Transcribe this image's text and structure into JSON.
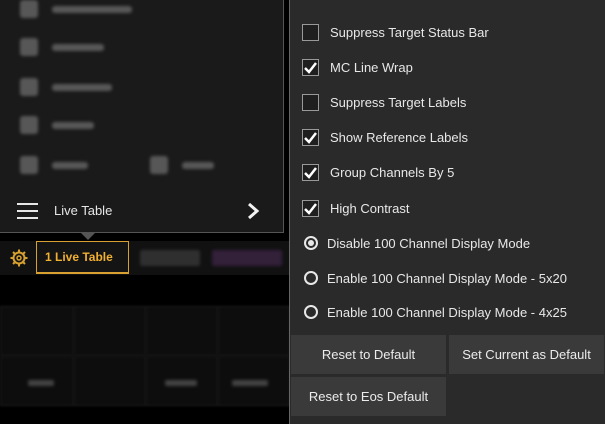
{
  "left_menu": {
    "live_table_label": "Live Table"
  },
  "tabs": {
    "active_label": "1 Live Table",
    "accent_color": "#f0b030"
  },
  "options": {
    "checkboxes": [
      {
        "label": "Suppress Target Status Bar",
        "checked": false
      },
      {
        "label": "MC Line Wrap",
        "checked": true
      },
      {
        "label": "Suppress Target Labels",
        "checked": false
      },
      {
        "label": "Show Reference Labels",
        "checked": true
      },
      {
        "label": "Group Channels By 5",
        "checked": true
      },
      {
        "label": "High Contrast",
        "checked": true
      }
    ],
    "radios": [
      {
        "label": "Disable 100 Channel Display Mode",
        "selected": true
      },
      {
        "label": "Enable 100 Channel Display Mode - 5x20",
        "selected": false
      },
      {
        "label": "Enable 100 Channel Display Mode - 4x25",
        "selected": false
      }
    ]
  },
  "buttons": {
    "reset_default": "Reset to Default",
    "set_current_default": "Set Current as Default",
    "reset_eos_default": "Reset to Eos Default"
  },
  "icons": [
    "hamburger-icon",
    "chevron-right-icon",
    "gear-icon",
    "checkmark-icon"
  ]
}
